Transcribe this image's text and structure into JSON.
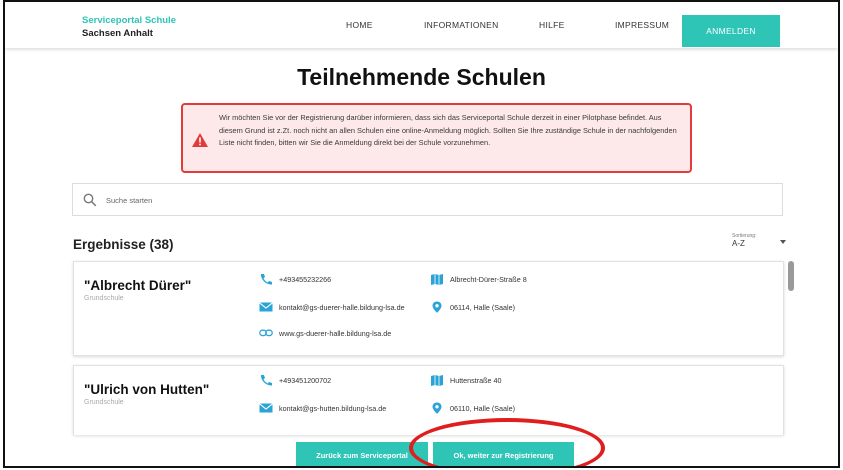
{
  "brand": {
    "line1": "Serviceportal Schule",
    "line2": "Sachsen Anhalt"
  },
  "nav": {
    "home": "HOME",
    "info": "INFORMATIONEN",
    "help": "HILFE",
    "impressum": "IMPRESSUM",
    "login": "ANMELDEN"
  },
  "page": {
    "title": "Teilnehmende Schulen"
  },
  "alert": {
    "text": "Wir möchten Sie vor der Registrierung darüber informieren, dass sich das Serviceportal Schule derzeit in einer Pilotphase befindet. Aus diesem Grund ist z.Zt. noch nicht an allen Schulen eine online-Anmeldung möglich. Sollten Sie Ihre zuständige Schule in der nachfolgenden Liste nicht finden, bitten wir Sie die Anmeldung direkt bei der Schule vorzunehmen.",
    "icon": "warning-icon"
  },
  "search": {
    "placeholder": "Suche starten",
    "value": ""
  },
  "results": {
    "title": "Ergebnisse (38)",
    "sort_label": "Sortierung:",
    "sort_value": "A-Z"
  },
  "schools": [
    {
      "name": "\"Albrecht Dürer\"",
      "type": "Grundschule",
      "phone": "+493455232266",
      "email": "kontakt@gs-duerer-halle.bildung-lsa.de",
      "website": "www.gs-duerer-halle.bildung-lsa.de",
      "street": "Albrecht-Dürer-Straße 8",
      "city": "06114, Halle (Saale)"
    },
    {
      "name": "\"Ulrich von Hutten\"",
      "type": "Grundschule",
      "phone": "+493451200702",
      "email": "kontakt@gs-hutten.bildung-lsa.de",
      "street": "Huttenstraße 40",
      "city": "06110, Halle (Saale)"
    }
  ],
  "buttons": {
    "back": "Zurück zum Serviceportal",
    "next": "Ok, weiter zur Registrierung"
  },
  "colors": {
    "accent": "#2ec4b6",
    "alert_border": "#e23b3b",
    "alert_bg": "#fde9e9",
    "highlight": "#e01e1e"
  }
}
